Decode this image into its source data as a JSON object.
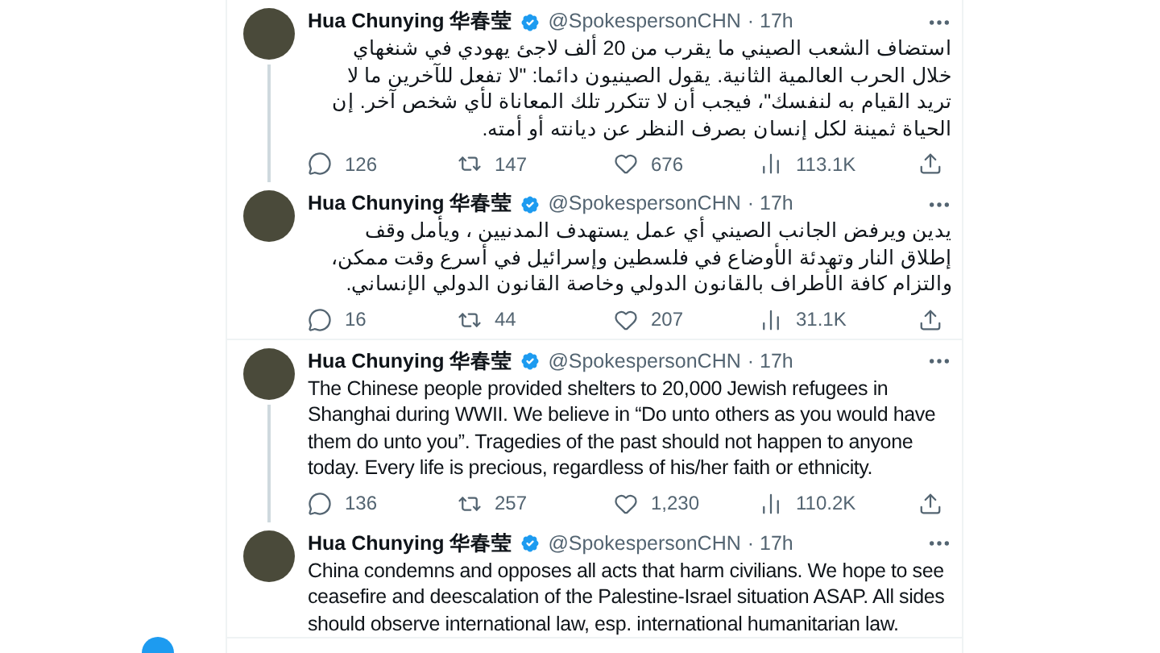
{
  "tweets": [
    {
      "name": "Hua Chunying 华春莹",
      "verified": true,
      "handle": "@SpokespersonCHN",
      "time": "· 17h",
      "connected": true,
      "text": "استضاف الشعب الصيني ما يقرب من 20 ألف لاجئ يهودي في شنغهاي خلال الحرب العالمية الثانية. يقول الصينيون دائما: \"لا تفعل للآخرين ما لا تريد القيام به لنفسك\"، فيجب أن لا تتكرر تلك المعاناة لأي شخص آخر. إن الحياة ثمينة لكل إنسان بصرف النظر عن ديانته أو أمته.",
      "replies": "126",
      "retweets": "147",
      "likes": "676",
      "views": "113.1K"
    },
    {
      "name": "Hua Chunying 华春莹",
      "verified": true,
      "handle": "@SpokespersonCHN",
      "time": "· 17h",
      "connected": false,
      "text": "يدين ويرفض الجانب الصيني أي عمل يستهدف المدنيين ، ويأمل وقف إطلاق النار وتهدئة الأوضاع في فلسطين وإسرائيل في أسرع وقت ممكن، والتزام كافة الأطراف بالقانون الدولي وخاصة القانون الدولي الإنساني.",
      "replies": "16",
      "retweets": "44",
      "likes": "207",
      "views": "31.1K"
    },
    {
      "name": "Hua Chunying 华春莹",
      "verified": true,
      "handle": "@SpokespersonCHN",
      "time": "· 17h",
      "connected": true,
      "text": "The Chinese people provided shelters to 20,000 Jewish refugees in Shanghai during WWII. We believe in “Do unto others as you would have them do unto you”. Tragedies of the past should not happen to anyone today. Every life is precious, regardless of his/her faith or ethnicity.",
      "replies": "136",
      "retweets": "257",
      "likes": "1,230",
      "views": "110.2K"
    },
    {
      "name": "Hua Chunying 华春莹",
      "verified": true,
      "handle": "@SpokespersonCHN",
      "time": "· 17h",
      "connected": false,
      "text": "China condemns and opposes all acts that harm civilians. We hope to see ceasefire and deescalation of the Palestine-Israel situation ASAP. All sides should observe international law, esp. international humanitarian law."
    }
  ]
}
